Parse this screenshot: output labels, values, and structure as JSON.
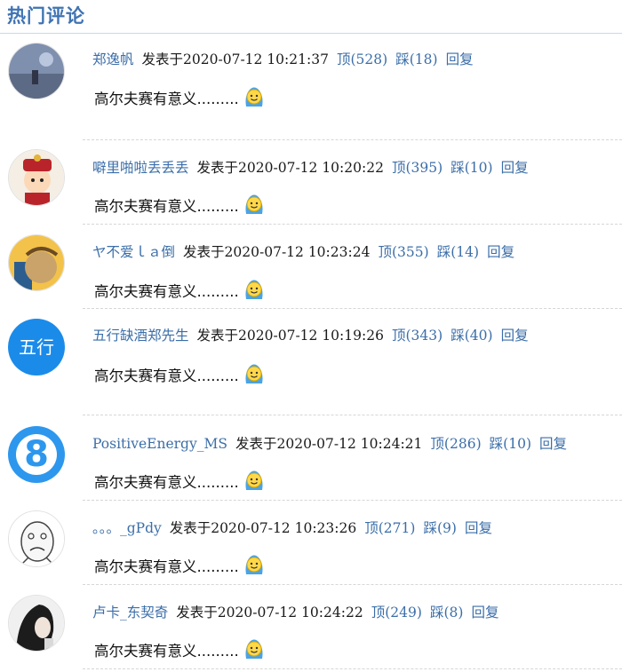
{
  "header": {
    "title": "热门评论"
  },
  "comment_labels": {
    "posted": "发表于",
    "up": "顶",
    "down": "踩",
    "reply": "回复"
  },
  "comments": [
    {
      "author": "郑逸帆",
      "time": "2020-07-12 10:21:37",
      "up": "528",
      "down": "18",
      "text": "高尔夫赛有意义.........",
      "avatar": "landscape-avatar"
    },
    {
      "author": "噼里啪啦丢丢丢",
      "time": "2020-07-12 10:20:22",
      "up": "395",
      "down": "10",
      "text": "高尔夫赛有意义.........",
      "avatar": "emperor-avatar"
    },
    {
      "author": "ヤ不爱ｌａ倒",
      "time": "2020-07-12 10:23:24",
      "up": "355",
      "down": "14",
      "text": "高尔夫赛有意义.........",
      "avatar": "cartoon-avatar"
    },
    {
      "author": "五行缺酒郑先生",
      "time": "2020-07-12 10:19:26",
      "up": "343",
      "down": "40",
      "text": "高尔夫赛有意义.........",
      "avatar": "text-avatar",
      "avatar_text": "五行"
    },
    {
      "author": "PositiveEnergy_MS",
      "time": "2020-07-12 10:24:21",
      "up": "286",
      "down": "10",
      "text": "高尔夫赛有意义.........",
      "avatar": "number-avatar",
      "avatar_text": "8"
    },
    {
      "author": "。。。_gPdy",
      "time": "2020-07-12 10:23:26",
      "up": "271",
      "down": "9",
      "text": "高尔夫赛有意义.........",
      "avatar": "meme-face-avatar"
    },
    {
      "author": "卢卡_东契奇",
      "time": "2020-07-12 10:24:22",
      "up": "249",
      "down": "8",
      "text": "高尔夫赛有意义.........",
      "avatar": "photo-avatar"
    }
  ],
  "colors": {
    "link": "#3b6ea8",
    "title": "#3f73b3",
    "divider": "#d6d6d6"
  },
  "emoji_icon": "smiley-emoji-icon"
}
